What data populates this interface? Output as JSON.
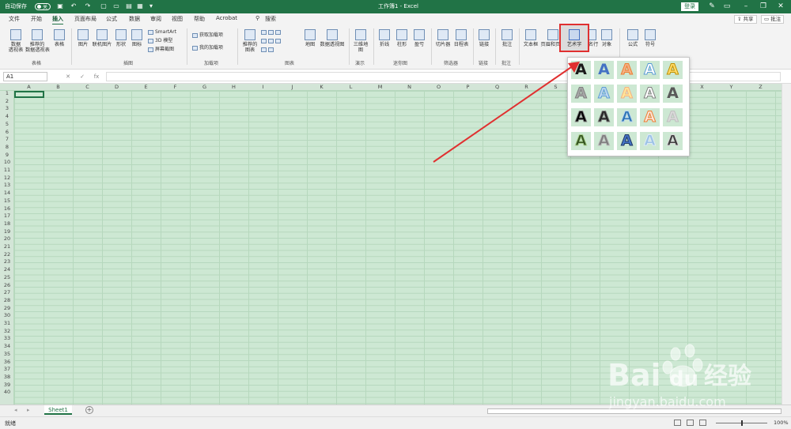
{
  "titlebar": {
    "autosave_label": "自动保存",
    "autosave_state": "关",
    "doc_title": "工作簿1 - Excel",
    "login_label": "登录"
  },
  "tabs": [
    "文件",
    "开始",
    "插入",
    "页面布局",
    "公式",
    "数据",
    "审阅",
    "视图",
    "帮助",
    "Acrobat"
  ],
  "search_label": "搜索",
  "share_label": "共享",
  "comment_label": "批注",
  "ribbon": {
    "buttons": [
      {
        "label": "数据\n透视表"
      },
      {
        "label": "推荐的\n数据透视表"
      },
      {
        "label": "表格"
      },
      {
        "label": "图片"
      },
      {
        "label": "联机图片"
      },
      {
        "label": "形状"
      },
      {
        "label": "图标"
      },
      {
        "label": "推荐的\n图表"
      },
      {
        "label": "地图"
      },
      {
        "label": "数据透视图"
      },
      {
        "label": "三维地\n图"
      },
      {
        "label": "折线"
      },
      {
        "label": "柱形"
      },
      {
        "label": "盈亏"
      },
      {
        "label": "切片器"
      },
      {
        "label": "日程表"
      },
      {
        "label": "链接"
      },
      {
        "label": "批注"
      },
      {
        "label": "文本框"
      },
      {
        "label": "页眉和页脚"
      },
      {
        "label": "艺术字"
      },
      {
        "label": "签名行"
      },
      {
        "label": "对象"
      },
      {
        "label": "公式"
      },
      {
        "label": "符号"
      }
    ],
    "small_items": [
      "SmartArt",
      "3D 模型",
      "屏幕截图",
      "获取加载项",
      "我的加载项"
    ],
    "groups": [
      "表格",
      "插图",
      "加载项",
      "图表",
      "演示",
      "迷你图",
      "筛选器",
      "链接",
      "批注"
    ]
  },
  "formula_bar": {
    "name_box": "A1",
    "fx": "fx",
    "cancel": "✕",
    "enter": "✓",
    "formula": ""
  },
  "columns": [
    "A",
    "B",
    "C",
    "D",
    "E",
    "F",
    "G",
    "H",
    "I",
    "J",
    "K",
    "L",
    "M",
    "N",
    "O",
    "P",
    "Q",
    "R",
    "S",
    "T",
    "U",
    "V",
    "W",
    "X",
    "Y",
    "Z"
  ],
  "rows": [
    "1",
    "2",
    "3",
    "4",
    "5",
    "6",
    "7",
    "8",
    "9",
    "10",
    "11",
    "12",
    "13",
    "14",
    "15",
    "16",
    "17",
    "18",
    "19",
    "20",
    "21",
    "22",
    "23",
    "24",
    "25",
    "26",
    "27",
    "28",
    "29",
    "30",
    "31",
    "32",
    "33",
    "34",
    "35",
    "36",
    "37",
    "38",
    "39",
    "40"
  ],
  "sheet_tab": "Sheet1",
  "add_sheet": "+",
  "status": {
    "ready": "就绪",
    "zoom": "100%"
  },
  "wordart_styles": [
    {
      "fill": "#1a1a1a",
      "stroke": "none"
    },
    {
      "fill": "#4472c4",
      "stroke": "none"
    },
    {
      "fill": "#f4b183",
      "stroke": "#ed7d31"
    },
    {
      "fill": "#ffffff",
      "stroke": "#5b9bd5"
    },
    {
      "fill": "#ffd966",
      "stroke": "#bf9000"
    },
    {
      "fill": "#a6a6a6",
      "stroke": "#7f7f7f"
    },
    {
      "fill": "#bdd7ee",
      "stroke": "#5b9bd5"
    },
    {
      "fill": "#ffe699",
      "stroke": "#f4b183"
    },
    {
      "fill": "#ffffff",
      "stroke": "#7f7f7f"
    },
    {
      "fill": "#595959",
      "stroke": "none"
    },
    {
      "fill": "#000000",
      "stroke": "#7f7f7f"
    },
    {
      "fill": "#262626",
      "stroke": "#7f7f7f"
    },
    {
      "fill": "#2e75b6",
      "stroke": "#bdd7ee"
    },
    {
      "fill": "#fce4d6",
      "stroke": "#ed7d31"
    },
    {
      "fill": "#d9d9d9",
      "stroke": "#bfbfbf"
    },
    {
      "fill": "#375623",
      "stroke": "#a9d18e"
    },
    {
      "fill": "#7f7f7f",
      "stroke": "#bfbfbf"
    },
    {
      "fill": "#4472c4",
      "stroke": "#1f3864"
    },
    {
      "fill": "#9dc3e6",
      "stroke": "#deebf7"
    },
    {
      "fill": "#404040",
      "stroke": "#d9d9d9"
    }
  ],
  "wordart_letter": "A",
  "watermark": {
    "brand": "Bai",
    "brand2": "du",
    "cn": "经验",
    "url": "jingyan.baidu.com"
  }
}
